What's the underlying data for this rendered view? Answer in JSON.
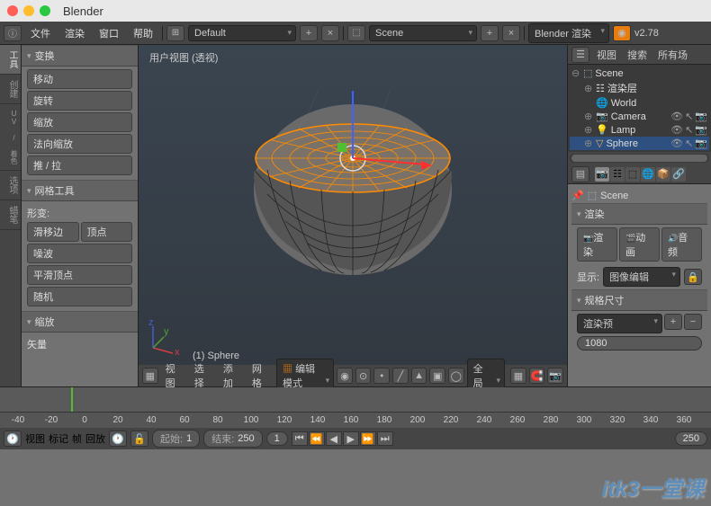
{
  "app": {
    "title": "Blender",
    "version": "v2.78"
  },
  "topbar": {
    "menus": [
      "文件",
      "渲染",
      "窗口",
      "帮助"
    ],
    "layout": "Default",
    "scene": "Scene",
    "renderer": "Blender 渲染"
  },
  "left_tabs": [
    "工具",
    "创建",
    "UV / 着色",
    "选项",
    "蜡笔"
  ],
  "tool_panel": {
    "transform": {
      "title": "变换",
      "buttons": [
        "移动",
        "旋转",
        "缩放",
        "法向缩放",
        "推 / 拉"
      ]
    },
    "mesh_tools": {
      "title": "网格工具",
      "deform_label": "形变:",
      "slide_edge": "滑移边",
      "vertex": "顶点",
      "noise": "噪波",
      "smooth_vertex": "平滑顶点",
      "randomize": "随机"
    },
    "scale": {
      "title": "缩放",
      "vector_label": "矢量"
    }
  },
  "viewport": {
    "header": "用户视图  (透视)",
    "object_name": "(1) Sphere",
    "axes": {
      "x": "x",
      "y": "y",
      "z": "z"
    },
    "bottom_menus": [
      "视图",
      "选择",
      "添加",
      "网格"
    ],
    "mode": "编辑模式",
    "orientation": "全局"
  },
  "outliner": {
    "header_tabs": [
      "视图",
      "搜索",
      "所有场"
    ],
    "items": [
      {
        "name": "Scene",
        "level": 0,
        "icon": "scene",
        "exp": "⊖"
      },
      {
        "name": "渲染层",
        "level": 1,
        "icon": "layers",
        "exp": "⊕"
      },
      {
        "name": "World",
        "level": 1,
        "icon": "world",
        "exp": ""
      },
      {
        "name": "Camera",
        "level": 1,
        "icon": "camera",
        "exp": "⊕"
      },
      {
        "name": "Lamp",
        "level": 1,
        "icon": "lamp",
        "exp": "⊕"
      },
      {
        "name": "Sphere",
        "level": 1,
        "icon": "mesh",
        "exp": "⊕",
        "sel": true
      }
    ]
  },
  "properties": {
    "breadcrumb": "Scene",
    "render_header": "渲染",
    "render_btn": "渲染",
    "anim_btn": "动画",
    "audio_btn": "音频",
    "display_label": "显示:",
    "display_value": "图像编辑",
    "dimensions_header": "规格尺寸",
    "preset": "渲染预",
    "res_x": "1080"
  },
  "timeline": {
    "ticks": [
      -40,
      -20,
      0,
      20,
      40,
      60,
      80,
      100,
      120,
      140,
      160,
      180,
      200,
      220,
      240,
      260,
      280,
      300,
      320,
      340,
      360
    ],
    "bottom_menus": [
      "视图",
      "标记",
      "帧",
      "回放"
    ],
    "start_label": "起始:",
    "start_val": "1",
    "end_label": "结束:",
    "end_val": "250",
    "current": "1",
    "final": "250"
  },
  "colors": {
    "selection": "#ff8c00",
    "axis_x": "#d04040",
    "axis_y": "#50a030",
    "axis_z": "#4060d0"
  }
}
